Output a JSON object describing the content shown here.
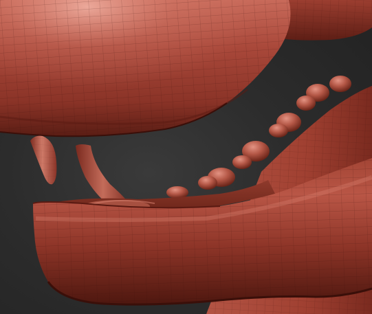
{
  "viewport": {
    "background_color": "#2a2a2a",
    "model_base_color": "#8e3528",
    "model_highlight_color": "#d98170",
    "model_shadow_color": "#3d120c",
    "wireframe_visible": true
  }
}
